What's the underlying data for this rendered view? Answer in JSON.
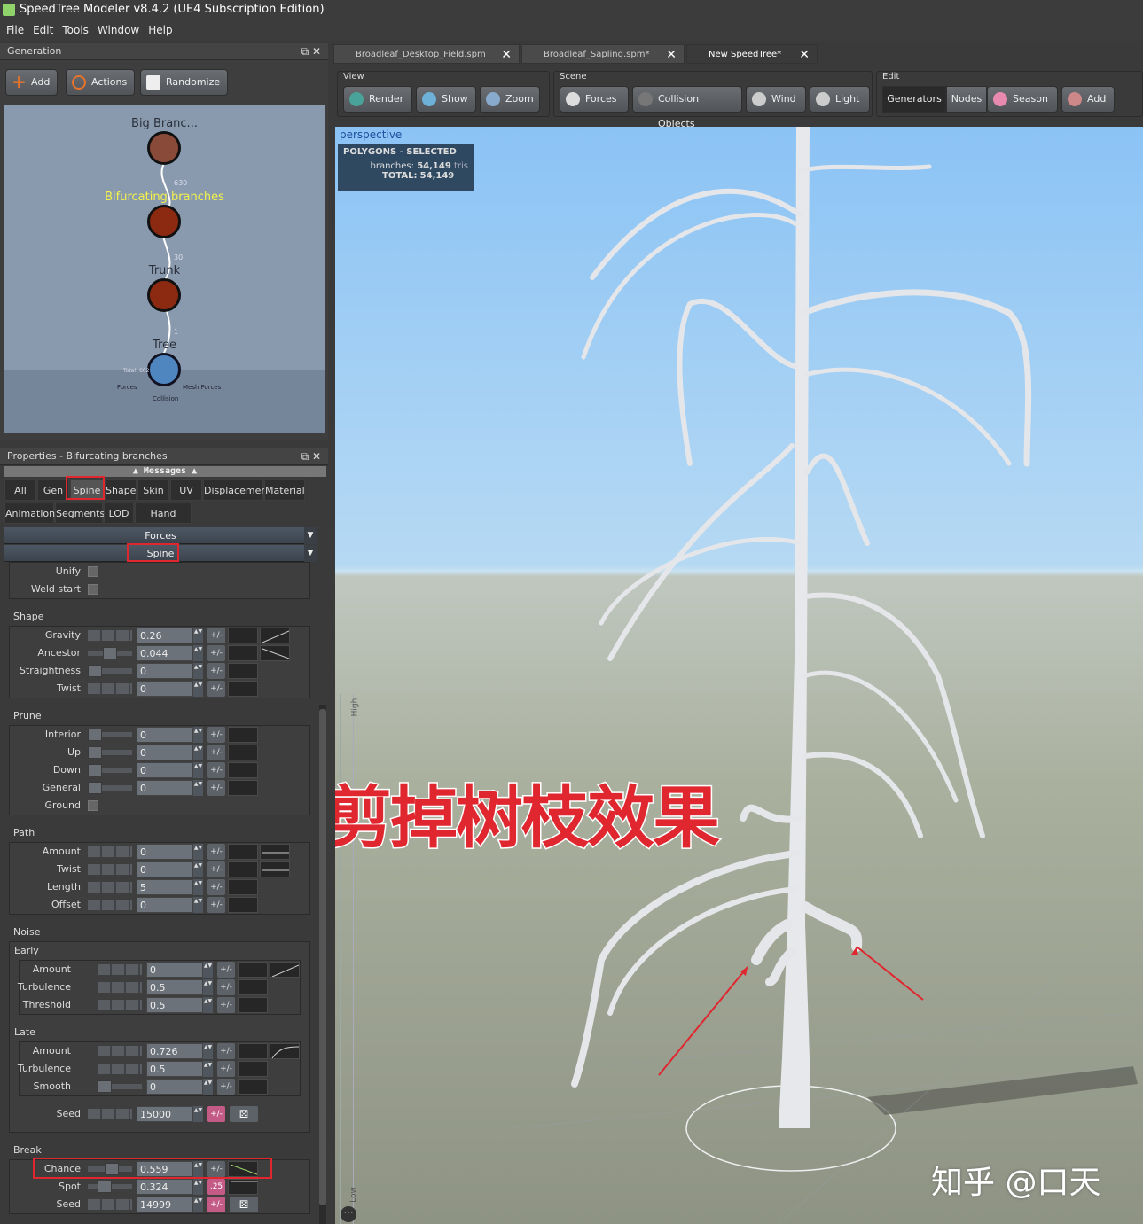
{
  "app": {
    "title": "SpeedTree Modeler v8.4.2 (UE4 Subscription Edition)",
    "menu": [
      "File",
      "Edit",
      "Tools",
      "Window",
      "Help"
    ]
  },
  "generation": {
    "title": "Generation",
    "buttons": [
      "Add",
      "Actions",
      "Randomize"
    ],
    "nodes": [
      {
        "label": "Big Branc...",
        "count": "630"
      },
      {
        "label": "Bifurcating branches",
        "count": "30",
        "selected": true
      },
      {
        "label": "Trunk",
        "count": "1"
      },
      {
        "label": "Tree",
        "count": "Total: 662"
      }
    ],
    "extras": [
      "Forces",
      "Collision",
      "Mesh Forces"
    ]
  },
  "properties": {
    "title": "Properties - Bifurcating branches",
    "messages": "Messages",
    "tabs_row1": [
      "All",
      "Gen",
      "Spine",
      "Shape",
      "Skin",
      "UV",
      "Displacement",
      "Material"
    ],
    "tabs_row2": [
      "Animation",
      "Segments",
      "LOD",
      "Hand Drawn"
    ],
    "active_tab": "Spine",
    "rollups": [
      "Forces",
      "Spine"
    ],
    "sections": [
      {
        "title": "",
        "rows": [
          {
            "label": "Unify",
            "type": "check"
          },
          {
            "label": "Weld start",
            "type": "check"
          }
        ]
      },
      {
        "title": "Shape",
        "rows": [
          {
            "label": "Gravity",
            "type": "seg",
            "value": "0.26",
            "curve2": "rise"
          },
          {
            "label": "Ancestor",
            "type": "knob",
            "pos": 0.5,
            "value": "0.044",
            "curve2": "fall"
          },
          {
            "label": "Straightness",
            "type": "knob",
            "pos": 0,
            "value": "0"
          },
          {
            "label": "Twist",
            "type": "seg",
            "value": "0"
          }
        ]
      },
      {
        "title": "Prune",
        "rows": [
          {
            "label": "Interior",
            "type": "knob",
            "pos": 0,
            "value": "0"
          },
          {
            "label": "Up",
            "type": "knob",
            "pos": 0,
            "value": "0"
          },
          {
            "label": "Down",
            "type": "knob",
            "pos": 0,
            "value": "0"
          },
          {
            "label": "General",
            "type": "knob",
            "pos": 0,
            "value": "0"
          },
          {
            "label": "Ground",
            "type": "check"
          }
        ]
      },
      {
        "title": "Path",
        "rows": [
          {
            "label": "Amount",
            "type": "seg",
            "value": "0",
            "curve2": "flat"
          },
          {
            "label": "Twist",
            "type": "seg",
            "value": "0",
            "curve2": "flat"
          },
          {
            "label": "Length",
            "type": "seg",
            "value": "5"
          },
          {
            "label": "Offset",
            "type": "seg",
            "value": "0"
          }
        ]
      },
      {
        "title": "Noise",
        "subs": [
          {
            "title": "Early",
            "rows": [
              {
                "label": "Amount",
                "type": "seg",
                "value": "0",
                "curve2": "rise"
              },
              {
                "label": "Turbulence",
                "type": "seg",
                "value": "0.5"
              },
              {
                "label": "Threshold",
                "type": "seg",
                "value": "0.5"
              }
            ]
          },
          {
            "title": "Late",
            "rows": [
              {
                "label": "Amount",
                "type": "seg",
                "value": "0.726",
                "curve2": "arc"
              },
              {
                "label": "Turbulence",
                "type": "seg",
                "value": "0.5"
              },
              {
                "label": "Smooth",
                "type": "knob",
                "pos": 0,
                "value": "0"
              }
            ]
          }
        ],
        "rows": [
          {
            "label": "Seed",
            "type": "seg",
            "value": "15000",
            "pm": "pink",
            "dice": true
          }
        ]
      },
      {
        "title": "Break",
        "rows": [
          {
            "label": "Chance",
            "type": "knob",
            "pos": 0.55,
            "value": "0.559",
            "highlight": true,
            "curve1": "fall"
          },
          {
            "label": "Spot",
            "type": "knob",
            "pos": 0.32,
            "value": "0.324",
            "pm": "pink",
            "pmLabel": ".25",
            "curve1": "flatHi"
          },
          {
            "label": "Seed",
            "type": "seg",
            "value": "14999",
            "pm": "pink",
            "dice": true
          }
        ]
      }
    ],
    "pm_label": "+/-"
  },
  "doc_tabs": [
    "Broadleaf_Desktop_Field.spm",
    "Broadleaf_Sapling.spm*",
    "New SpeedTree*"
  ],
  "toolbar": {
    "groups": [
      {
        "title": "View",
        "buttons": [
          "Render",
          "Show",
          "Zoom"
        ]
      },
      {
        "title": "Scene",
        "buttons": [
          "Forces",
          "Collision Objects",
          "Wind",
          "Light"
        ]
      },
      {
        "title": "Edit",
        "buttons": [
          "Generators",
          "Nodes",
          "Season",
          "Add"
        ]
      }
    ]
  },
  "viewport": {
    "camera": "perspective",
    "stats_title": "POLYGONS - SELECTED",
    "branches_label": "branches:",
    "branches_value": "54,149",
    "branches_unit": "tris",
    "total_label": "TOTAL:",
    "total_value": "54,149",
    "scale_high": "High",
    "scale_low": "Low",
    "overlay_text": "剪掉树枝效果",
    "watermark": "知乎 @口天"
  },
  "colors": {
    "accent": "#e0262e",
    "selected_node": "#f2f24a",
    "pink": "#c45b86"
  }
}
